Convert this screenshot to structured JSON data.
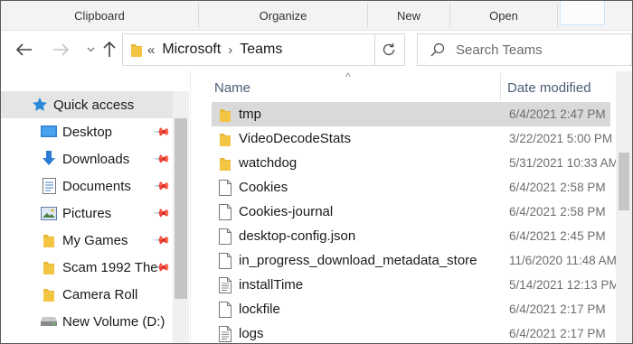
{
  "ribbon": {
    "groups": [
      "Clipboard",
      "Organize",
      "New",
      "Open"
    ]
  },
  "address": {
    "overflow": "«",
    "crumbs": [
      "Microsoft",
      "Teams"
    ],
    "separator": "›"
  },
  "search": {
    "placeholder": "Search Teams"
  },
  "columns": {
    "name": "Name",
    "date": "Date modified"
  },
  "sidebar": {
    "items": [
      {
        "label": "Quick access",
        "icon": "star-icon"
      },
      {
        "label": "Desktop",
        "icon": "desktop-icon",
        "pinned": true
      },
      {
        "label": "Downloads",
        "icon": "download-arrow-icon",
        "pinned": true
      },
      {
        "label": "Documents",
        "icon": "documents-icon",
        "pinned": true
      },
      {
        "label": "Pictures",
        "icon": "pictures-icon",
        "pinned": true
      },
      {
        "label": "My Games",
        "icon": "folder-icon",
        "pinned": true
      },
      {
        "label": "Scam 1992 The",
        "icon": "folder-icon",
        "pinned": true
      },
      {
        "label": "Camera Roll",
        "icon": "folder-icon"
      },
      {
        "label": "New Volume (D:)",
        "icon": "drive-icon"
      }
    ]
  },
  "files": [
    {
      "name": "tmp",
      "date": "6/4/2021 2:47 PM",
      "icon": "folder-icon"
    },
    {
      "name": "VideoDecodeStats",
      "date": "3/22/2021 5:00 PM",
      "icon": "folder-icon"
    },
    {
      "name": "watchdog",
      "date": "5/31/2021 10:33 AM",
      "icon": "folder-icon"
    },
    {
      "name": "Cookies",
      "date": "6/4/2021 2:58 PM",
      "icon": "file-icon"
    },
    {
      "name": "Cookies-journal",
      "date": "6/4/2021 2:58 PM",
      "icon": "file-icon"
    },
    {
      "name": "desktop-config.json",
      "date": "6/4/2021 2:45 PM",
      "icon": "file-icon"
    },
    {
      "name": "in_progress_download_metadata_store",
      "date": "11/6/2020 11:48 AM",
      "icon": "file-icon"
    },
    {
      "name": "installTime",
      "date": "5/14/2021 12:13 PM",
      "icon": "text-file-icon"
    },
    {
      "name": "lockfile",
      "date": "6/4/2021 2:17 PM",
      "icon": "file-icon"
    },
    {
      "name": "logs",
      "date": "6/4/2021 2:17 PM",
      "icon": "text-file-icon"
    }
  ],
  "colors": {
    "folder": "#e8b93a",
    "selection": "#d9d9d9",
    "quick_access_star": "#2b88d8",
    "column_header_text": "#4a5d7a"
  }
}
